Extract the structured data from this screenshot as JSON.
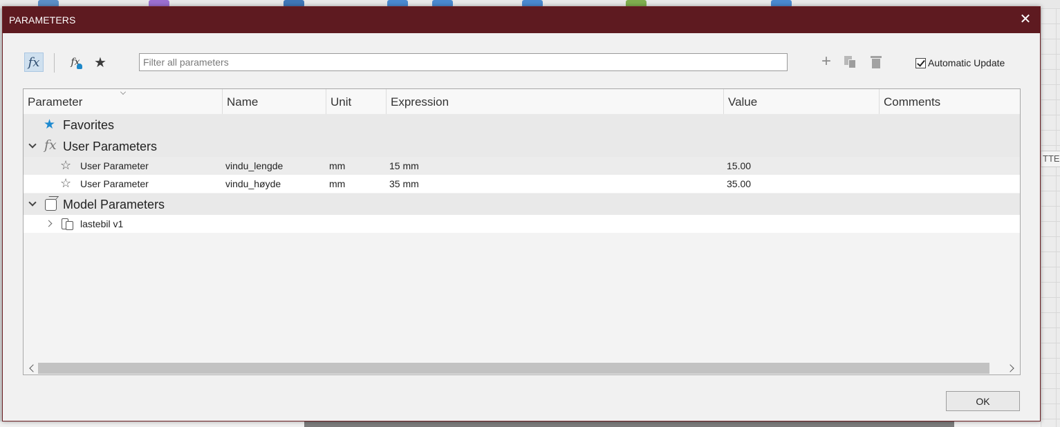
{
  "dialog": {
    "title": "PARAMETERS",
    "close_glyph": "✕"
  },
  "toolbar": {
    "fx_all_glyph": "fx",
    "fx_user_glyph": "fx",
    "favorites_glyph": "★",
    "filter_placeholder": "Filter all parameters",
    "filter_value": "",
    "add_glyph": "+",
    "automatic_update_label": "Automatic Update",
    "automatic_update_checked": true
  },
  "table": {
    "columns": [
      "Parameter",
      "Name",
      "Unit",
      "Expression",
      "Value",
      "Comments"
    ],
    "favorites_label": "Favorites",
    "user_group_label": "User Parameters",
    "user_rows": [
      {
        "parameter": "User Parameter",
        "name": "vindu_lengde",
        "unit": "mm",
        "expression": "15 mm",
        "value": "15.00",
        "comments": ""
      },
      {
        "parameter": "User Parameter",
        "name": "vindu_høyde",
        "unit": "mm",
        "expression": "35 mm",
        "value": "35.00",
        "comments": ""
      }
    ],
    "model_group_label": "Model Parameters",
    "model_rows": [
      {
        "label": "lastebil v1"
      }
    ]
  },
  "buttons": {
    "ok_label": "OK"
  },
  "background": {
    "side_tab_text": "TTE"
  },
  "icons": {
    "favorites": "star-icon",
    "user_params": "fx-icon",
    "model_params": "cube-icon",
    "component": "component-icon",
    "favorite_toggle": "star-outline-icon"
  },
  "colors": {
    "titlebar": "#5e1a20",
    "accent_blue": "#1e8ad0",
    "active_filter_bg": "#cfe0ef"
  }
}
